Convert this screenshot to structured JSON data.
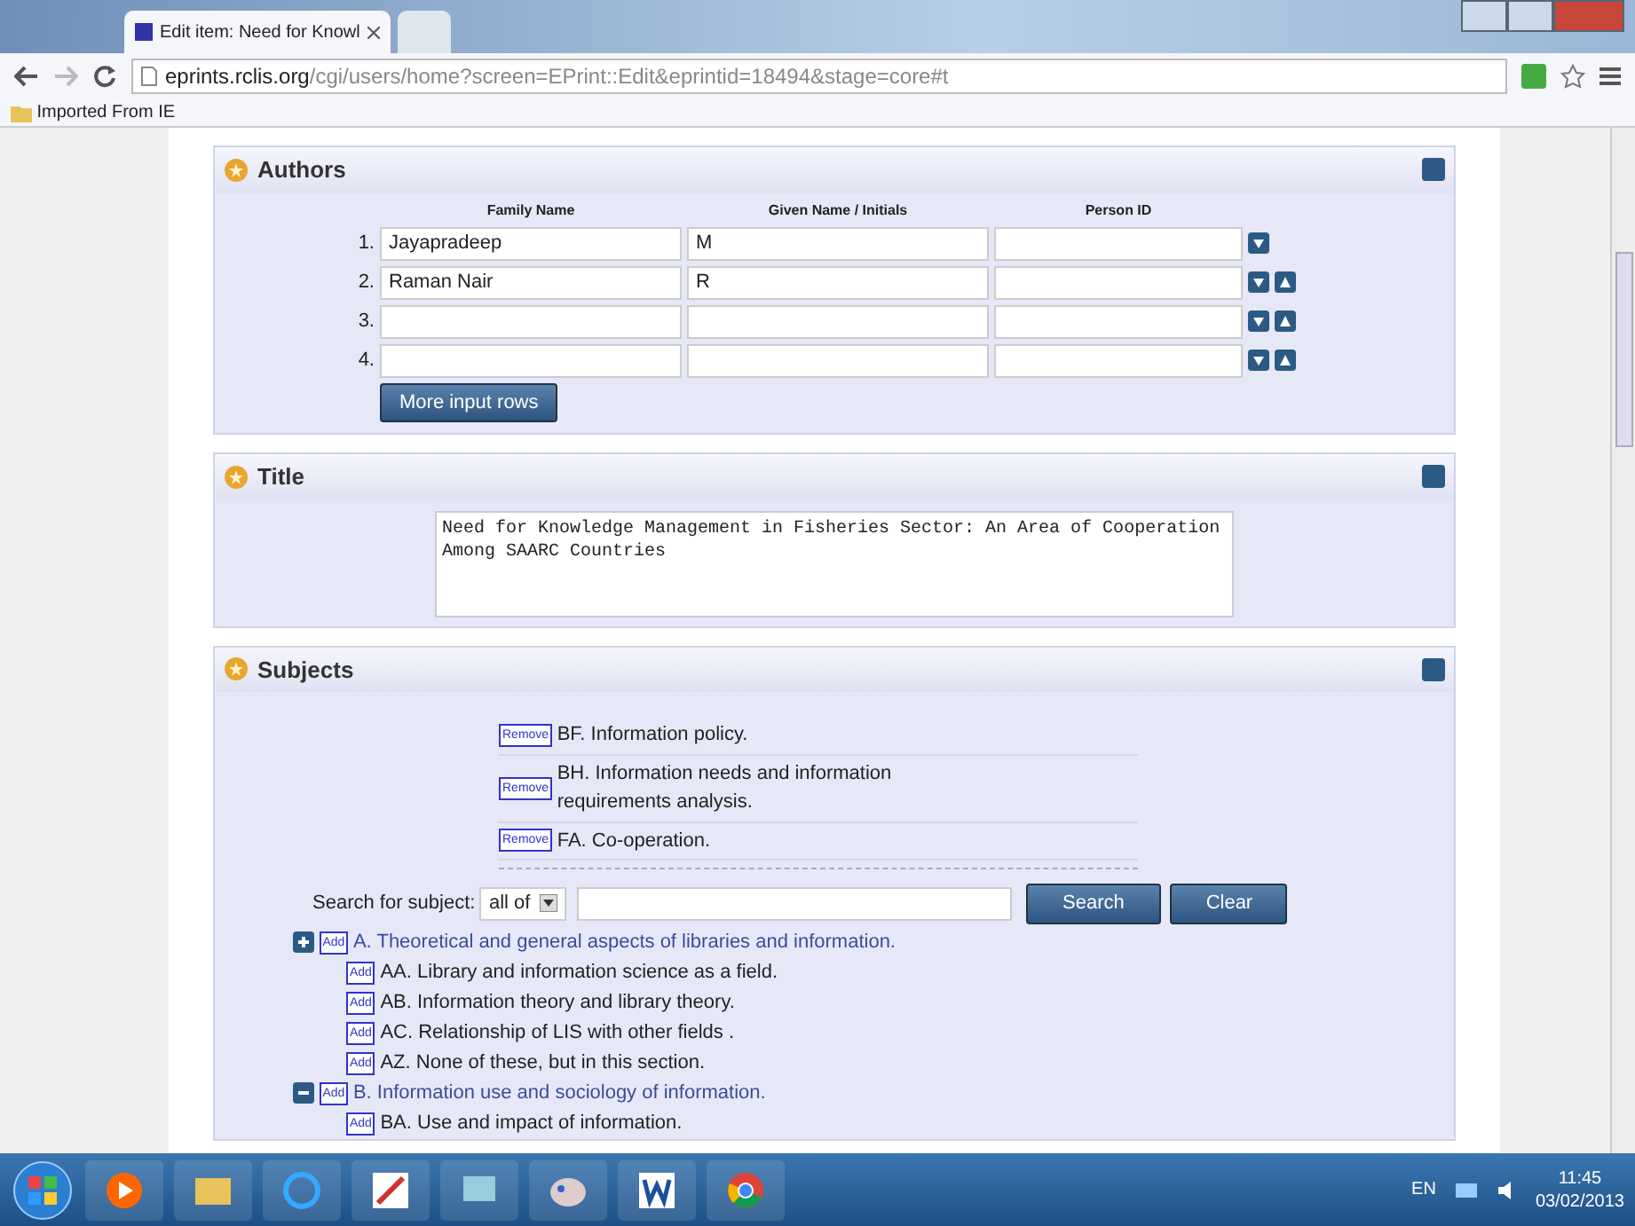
{
  "browser": {
    "tab_title": "Edit item: Need for Knowl",
    "url_host": "eprints.rclis.org",
    "url_path": "/cgi/users/home?screen=EPrint::Edit&eprintid=18494&stage=core#t",
    "bookmark": "Imported From IE"
  },
  "authors": {
    "title": "Authors",
    "columns": [
      "Family Name",
      "Given Name / Initials",
      "Person ID"
    ],
    "rows": [
      {
        "number": "1.",
        "family": "Jayapradeep",
        "given": "M",
        "person_id": "",
        "can_move_up": false
      },
      {
        "number": "2.",
        "family": "Raman Nair",
        "given": "R",
        "person_id": "",
        "can_move_up": true
      },
      {
        "number": "3.",
        "family": "",
        "given": "",
        "person_id": "",
        "can_move_up": true
      },
      {
        "number": "4.",
        "family": "",
        "given": "",
        "person_id": "",
        "can_move_up": true
      }
    ],
    "more_button": "More input rows"
  },
  "title_section": {
    "title": "Title",
    "value": "Need for Knowledge Management in Fisheries Sector: An Area of Cooperation Among SAARC Countries"
  },
  "subjects": {
    "title": "Subjects",
    "selected": [
      {
        "remove_label": "Remove",
        "text": "BF. Information policy."
      },
      {
        "remove_label": "Remove",
        "text": "BH. Information needs and information requirements analysis."
      },
      {
        "remove_label": "Remove",
        "text": "FA. Co-operation."
      }
    ],
    "search_label": "Search for subject:",
    "match_value": "all of",
    "search_button": "Search",
    "clear_button": "Clear",
    "tree": [
      {
        "add_label": "Add",
        "text": "A. Theoretical and general aspects of libraries and information.",
        "expanded": false,
        "children": [
          {
            "add_label": "Add",
            "text": "AA. Library and information science as a field."
          },
          {
            "add_label": "Add",
            "text": "AB. Information theory and library theory."
          },
          {
            "add_label": "Add",
            "text": "AC. Relationship of LIS with other fields ."
          },
          {
            "add_label": "Add",
            "text": "AZ. None of these, but in this section."
          }
        ]
      },
      {
        "add_label": "Add",
        "text": "B. Information use and sociology of information.",
        "expanded": true,
        "children": [
          {
            "add_label": "Add",
            "text": "BA. Use and impact of information."
          }
        ]
      }
    ]
  },
  "taskbar": {
    "language": "EN",
    "time": "11:45",
    "date": "03/02/2013"
  }
}
